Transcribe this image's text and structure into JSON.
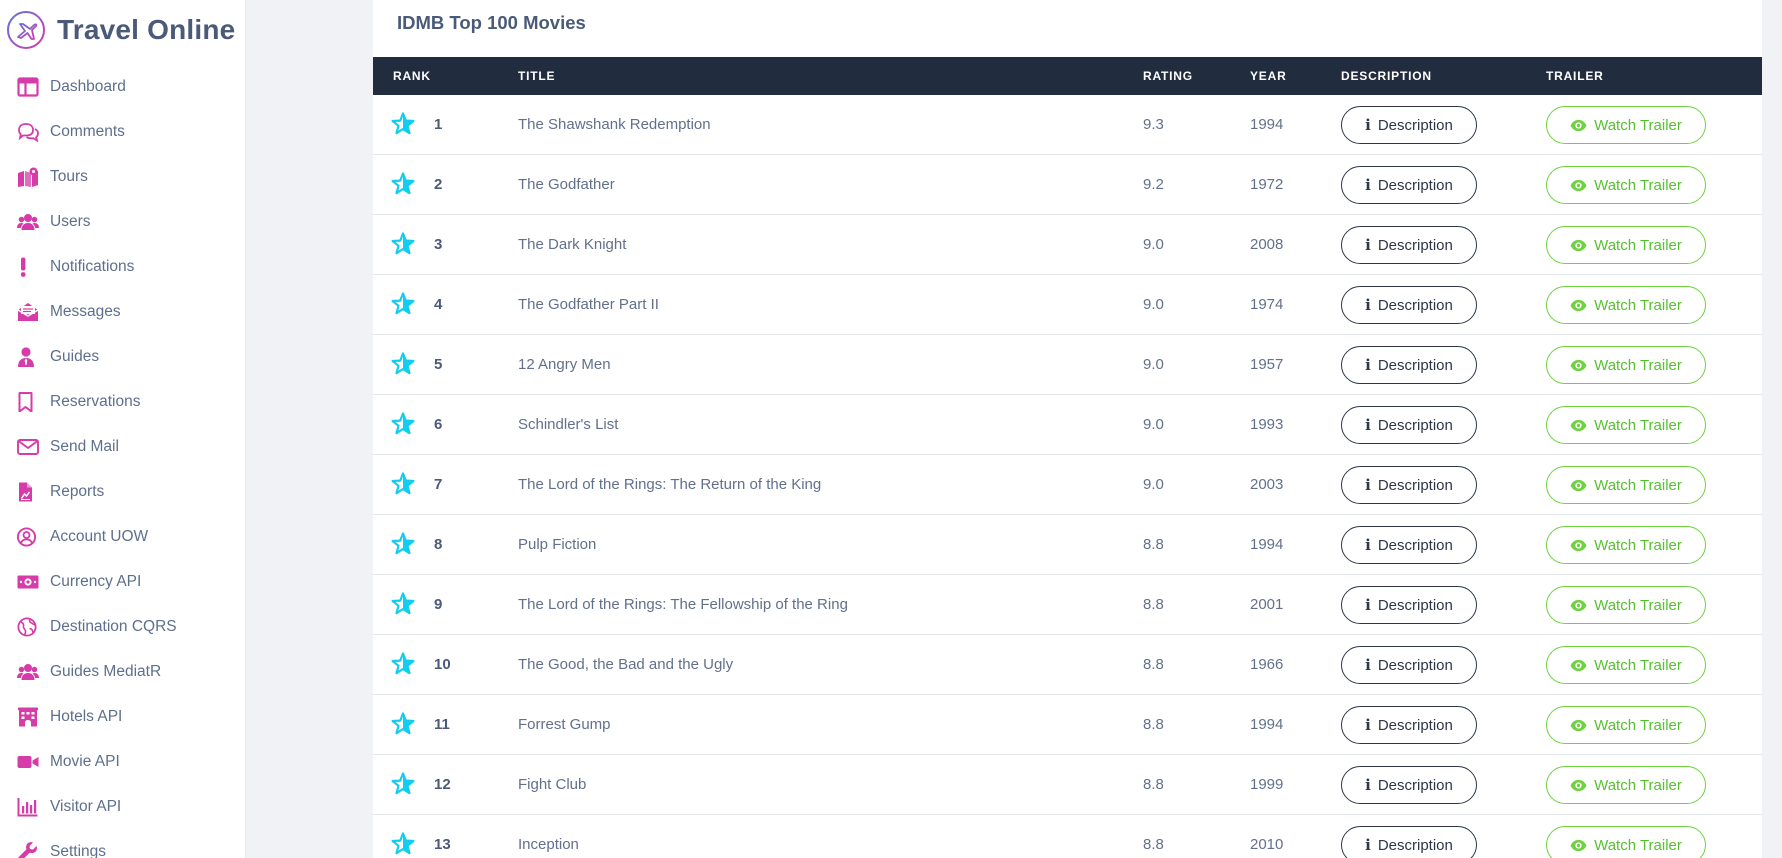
{
  "app": {
    "title": "Travel Online"
  },
  "sidebar": {
    "accent_color": "#d63ca9",
    "items": [
      {
        "label": "Dashboard",
        "icon": "dashboard-icon"
      },
      {
        "label": "Comments",
        "icon": "comments-icon"
      },
      {
        "label": "Tours",
        "icon": "map-icon"
      },
      {
        "label": "Users",
        "icon": "users-icon"
      },
      {
        "label": "Notifications",
        "icon": "exclamation-icon"
      },
      {
        "label": "Messages",
        "icon": "envelope-open-icon"
      },
      {
        "label": "Guides",
        "icon": "user-tie-icon"
      },
      {
        "label": "Reservations",
        "icon": "bookmark-icon"
      },
      {
        "label": "Send Mail",
        "icon": "envelope-icon"
      },
      {
        "label": "Reports",
        "icon": "file-chart-icon"
      },
      {
        "label": "Account UOW",
        "icon": "user-circle-icon"
      },
      {
        "label": "Currency API",
        "icon": "money-bill-icon"
      },
      {
        "label": "Destination CQRS",
        "icon": "globe-icon"
      },
      {
        "label": "Guides MediatR",
        "icon": "users-icon"
      },
      {
        "label": "Hotels API",
        "icon": "hotel-icon"
      },
      {
        "label": "Movie API",
        "icon": "video-icon"
      },
      {
        "label": "Visitor API",
        "icon": "chart-bar-icon"
      },
      {
        "label": "Settings",
        "icon": "wrench-icon"
      }
    ]
  },
  "card": {
    "title": "IDMB Top 100 Movies"
  },
  "table": {
    "headers": {
      "rank": "RANK",
      "title": "TITLE",
      "rating": "RATING",
      "year": "YEAR",
      "description": "DESCRIPTION",
      "trailer": "TRAILER"
    },
    "description_label": "Description",
    "trailer_label": "Watch Trailer",
    "star_color": "#11cdef",
    "trailer_color": "#6fd23f",
    "rows": [
      {
        "rank": "1",
        "title": "The Shawshank Redemption",
        "rating": "9.3",
        "year": "1994"
      },
      {
        "rank": "2",
        "title": "The Godfather",
        "rating": "9.2",
        "year": "1972"
      },
      {
        "rank": "3",
        "title": "The Dark Knight",
        "rating": "9.0",
        "year": "2008"
      },
      {
        "rank": "4",
        "title": "The Godfather Part II",
        "rating": "9.0",
        "year": "1974"
      },
      {
        "rank": "5",
        "title": "12 Angry Men",
        "rating": "9.0",
        "year": "1957"
      },
      {
        "rank": "6",
        "title": "Schindler's List",
        "rating": "9.0",
        "year": "1993"
      },
      {
        "rank": "7",
        "title": "The Lord of the Rings: The Return of the King",
        "rating": "9.0",
        "year": "2003"
      },
      {
        "rank": "8",
        "title": "Pulp Fiction",
        "rating": "8.8",
        "year": "1994"
      },
      {
        "rank": "9",
        "title": "The Lord of the Rings: The Fellowship of the Ring",
        "rating": "8.8",
        "year": "2001"
      },
      {
        "rank": "10",
        "title": "The Good, the Bad and the Ugly",
        "rating": "8.8",
        "year": "1966"
      },
      {
        "rank": "11",
        "title": "Forrest Gump",
        "rating": "8.8",
        "year": "1994"
      },
      {
        "rank": "12",
        "title": "Fight Club",
        "rating": "8.8",
        "year": "1999"
      },
      {
        "rank": "13",
        "title": "Inception",
        "rating": "8.8",
        "year": "2010"
      }
    ]
  }
}
